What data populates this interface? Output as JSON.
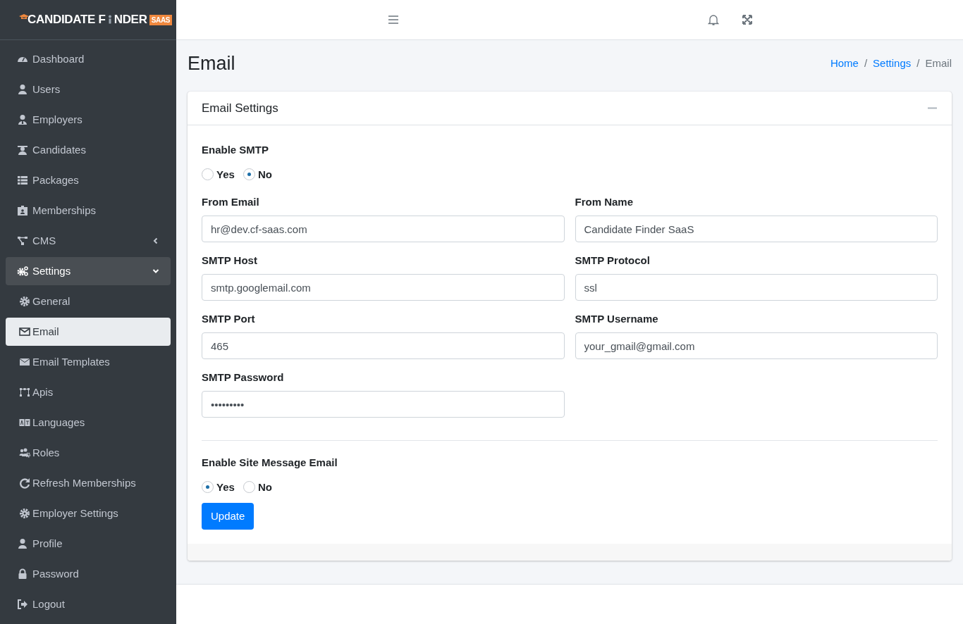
{
  "logo": {
    "text_before": "CANDIDATE F",
    "text_after": "NDER",
    "badge": "SAAS"
  },
  "sidebar": {
    "items": [
      {
        "kind": "item",
        "label": "Dashboard",
        "selected": false
      },
      {
        "kind": "item",
        "label": "Users",
        "selected": false
      },
      {
        "kind": "item",
        "label": "Employers",
        "selected": false
      },
      {
        "kind": "item",
        "label": "Candidates",
        "selected": false
      },
      {
        "kind": "item",
        "label": "Packages",
        "selected": false
      },
      {
        "kind": "item",
        "label": "Memberships",
        "selected": false
      },
      {
        "kind": "group",
        "label": "CMS",
        "expanded": false
      },
      {
        "kind": "group",
        "label": "Settings",
        "expanded": true,
        "children": [
          {
            "label": "General",
            "selected": false
          },
          {
            "label": "Email",
            "selected": true
          },
          {
            "label": "Email Templates",
            "selected": false
          },
          {
            "label": "Apis",
            "selected": false
          },
          {
            "label": "Languages",
            "selected": false
          },
          {
            "label": "Roles",
            "selected": false
          },
          {
            "label": "Refresh Memberships",
            "selected": false
          },
          {
            "label": "Employer Settings",
            "selected": false
          }
        ]
      },
      {
        "kind": "item",
        "label": "Profile",
        "selected": false
      },
      {
        "kind": "item",
        "label": "Password",
        "selected": false
      },
      {
        "kind": "item",
        "label": "Logout",
        "selected": false
      }
    ]
  },
  "page": {
    "title": "Email",
    "breadcrumb_separator": "/",
    "breadcrumb": [
      {
        "label": "Home",
        "link": true
      },
      {
        "label": "Settings",
        "link": true
      },
      {
        "label": "Email",
        "link": false
      }
    ]
  },
  "card": {
    "title": "Email Settings",
    "enable_smtp": {
      "label": "Enable SMTP",
      "options": [
        {
          "label": "Yes",
          "selected": false
        },
        {
          "label": "No",
          "selected": true
        }
      ]
    },
    "fields": [
      {
        "label": "From Email",
        "value": "hr@dev.cf-saas.com"
      },
      {
        "label": "From Name",
        "value": "Candidate Finder SaaS"
      },
      {
        "label": "SMTP Host",
        "value": "smtp.googlemail.com"
      },
      {
        "label": "SMTP Protocol",
        "value": "ssl"
      },
      {
        "label": "SMTP Port",
        "value": "465"
      },
      {
        "label": "SMTP Username",
        "value": "your_gmail@gmail.com"
      },
      {
        "label": "SMTP Password",
        "value": "•••••••••"
      }
    ],
    "enable_site_message_email": {
      "label": "Enable Site Message Email",
      "options": [
        {
          "label": "Yes",
          "selected": true
        },
        {
          "label": "No",
          "selected": false
        }
      ]
    },
    "button": "Update"
  }
}
